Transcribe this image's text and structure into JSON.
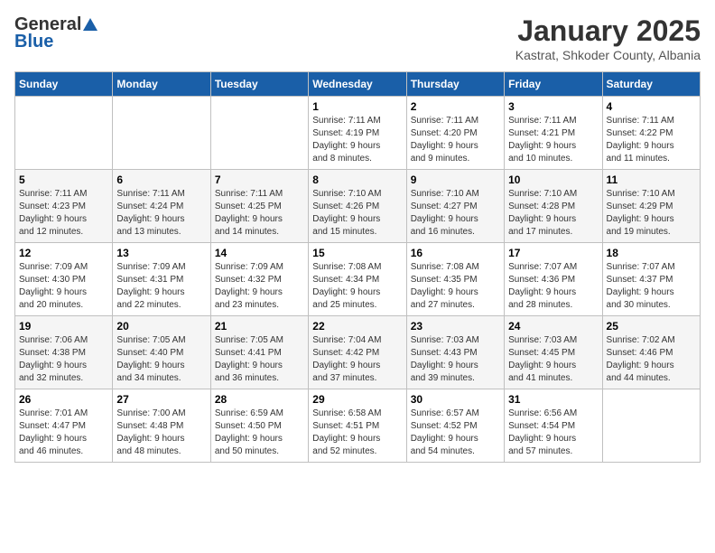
{
  "header": {
    "logo_general": "General",
    "logo_blue": "Blue",
    "month_title": "January 2025",
    "subtitle": "Kastrat, Shkoder County, Albania"
  },
  "weekdays": [
    "Sunday",
    "Monday",
    "Tuesday",
    "Wednesday",
    "Thursday",
    "Friday",
    "Saturday"
  ],
  "weeks": [
    [
      {
        "day": "",
        "info": ""
      },
      {
        "day": "",
        "info": ""
      },
      {
        "day": "",
        "info": ""
      },
      {
        "day": "1",
        "info": "Sunrise: 7:11 AM\nSunset: 4:19 PM\nDaylight: 9 hours\nand 8 minutes."
      },
      {
        "day": "2",
        "info": "Sunrise: 7:11 AM\nSunset: 4:20 PM\nDaylight: 9 hours\nand 9 minutes."
      },
      {
        "day": "3",
        "info": "Sunrise: 7:11 AM\nSunset: 4:21 PM\nDaylight: 9 hours\nand 10 minutes."
      },
      {
        "day": "4",
        "info": "Sunrise: 7:11 AM\nSunset: 4:22 PM\nDaylight: 9 hours\nand 11 minutes."
      }
    ],
    [
      {
        "day": "5",
        "info": "Sunrise: 7:11 AM\nSunset: 4:23 PM\nDaylight: 9 hours\nand 12 minutes."
      },
      {
        "day": "6",
        "info": "Sunrise: 7:11 AM\nSunset: 4:24 PM\nDaylight: 9 hours\nand 13 minutes."
      },
      {
        "day": "7",
        "info": "Sunrise: 7:11 AM\nSunset: 4:25 PM\nDaylight: 9 hours\nand 14 minutes."
      },
      {
        "day": "8",
        "info": "Sunrise: 7:10 AM\nSunset: 4:26 PM\nDaylight: 9 hours\nand 15 minutes."
      },
      {
        "day": "9",
        "info": "Sunrise: 7:10 AM\nSunset: 4:27 PM\nDaylight: 9 hours\nand 16 minutes."
      },
      {
        "day": "10",
        "info": "Sunrise: 7:10 AM\nSunset: 4:28 PM\nDaylight: 9 hours\nand 17 minutes."
      },
      {
        "day": "11",
        "info": "Sunrise: 7:10 AM\nSunset: 4:29 PM\nDaylight: 9 hours\nand 19 minutes."
      }
    ],
    [
      {
        "day": "12",
        "info": "Sunrise: 7:09 AM\nSunset: 4:30 PM\nDaylight: 9 hours\nand 20 minutes."
      },
      {
        "day": "13",
        "info": "Sunrise: 7:09 AM\nSunset: 4:31 PM\nDaylight: 9 hours\nand 22 minutes."
      },
      {
        "day": "14",
        "info": "Sunrise: 7:09 AM\nSunset: 4:32 PM\nDaylight: 9 hours\nand 23 minutes."
      },
      {
        "day": "15",
        "info": "Sunrise: 7:08 AM\nSunset: 4:34 PM\nDaylight: 9 hours\nand 25 minutes."
      },
      {
        "day": "16",
        "info": "Sunrise: 7:08 AM\nSunset: 4:35 PM\nDaylight: 9 hours\nand 27 minutes."
      },
      {
        "day": "17",
        "info": "Sunrise: 7:07 AM\nSunset: 4:36 PM\nDaylight: 9 hours\nand 28 minutes."
      },
      {
        "day": "18",
        "info": "Sunrise: 7:07 AM\nSunset: 4:37 PM\nDaylight: 9 hours\nand 30 minutes."
      }
    ],
    [
      {
        "day": "19",
        "info": "Sunrise: 7:06 AM\nSunset: 4:38 PM\nDaylight: 9 hours\nand 32 minutes."
      },
      {
        "day": "20",
        "info": "Sunrise: 7:05 AM\nSunset: 4:40 PM\nDaylight: 9 hours\nand 34 minutes."
      },
      {
        "day": "21",
        "info": "Sunrise: 7:05 AM\nSunset: 4:41 PM\nDaylight: 9 hours\nand 36 minutes."
      },
      {
        "day": "22",
        "info": "Sunrise: 7:04 AM\nSunset: 4:42 PM\nDaylight: 9 hours\nand 37 minutes."
      },
      {
        "day": "23",
        "info": "Sunrise: 7:03 AM\nSunset: 4:43 PM\nDaylight: 9 hours\nand 39 minutes."
      },
      {
        "day": "24",
        "info": "Sunrise: 7:03 AM\nSunset: 4:45 PM\nDaylight: 9 hours\nand 41 minutes."
      },
      {
        "day": "25",
        "info": "Sunrise: 7:02 AM\nSunset: 4:46 PM\nDaylight: 9 hours\nand 44 minutes."
      }
    ],
    [
      {
        "day": "26",
        "info": "Sunrise: 7:01 AM\nSunset: 4:47 PM\nDaylight: 9 hours\nand 46 minutes."
      },
      {
        "day": "27",
        "info": "Sunrise: 7:00 AM\nSunset: 4:48 PM\nDaylight: 9 hours\nand 48 minutes."
      },
      {
        "day": "28",
        "info": "Sunrise: 6:59 AM\nSunset: 4:50 PM\nDaylight: 9 hours\nand 50 minutes."
      },
      {
        "day": "29",
        "info": "Sunrise: 6:58 AM\nSunset: 4:51 PM\nDaylight: 9 hours\nand 52 minutes."
      },
      {
        "day": "30",
        "info": "Sunrise: 6:57 AM\nSunset: 4:52 PM\nDaylight: 9 hours\nand 54 minutes."
      },
      {
        "day": "31",
        "info": "Sunrise: 6:56 AM\nSunset: 4:54 PM\nDaylight: 9 hours\nand 57 minutes."
      },
      {
        "day": "",
        "info": ""
      }
    ]
  ]
}
